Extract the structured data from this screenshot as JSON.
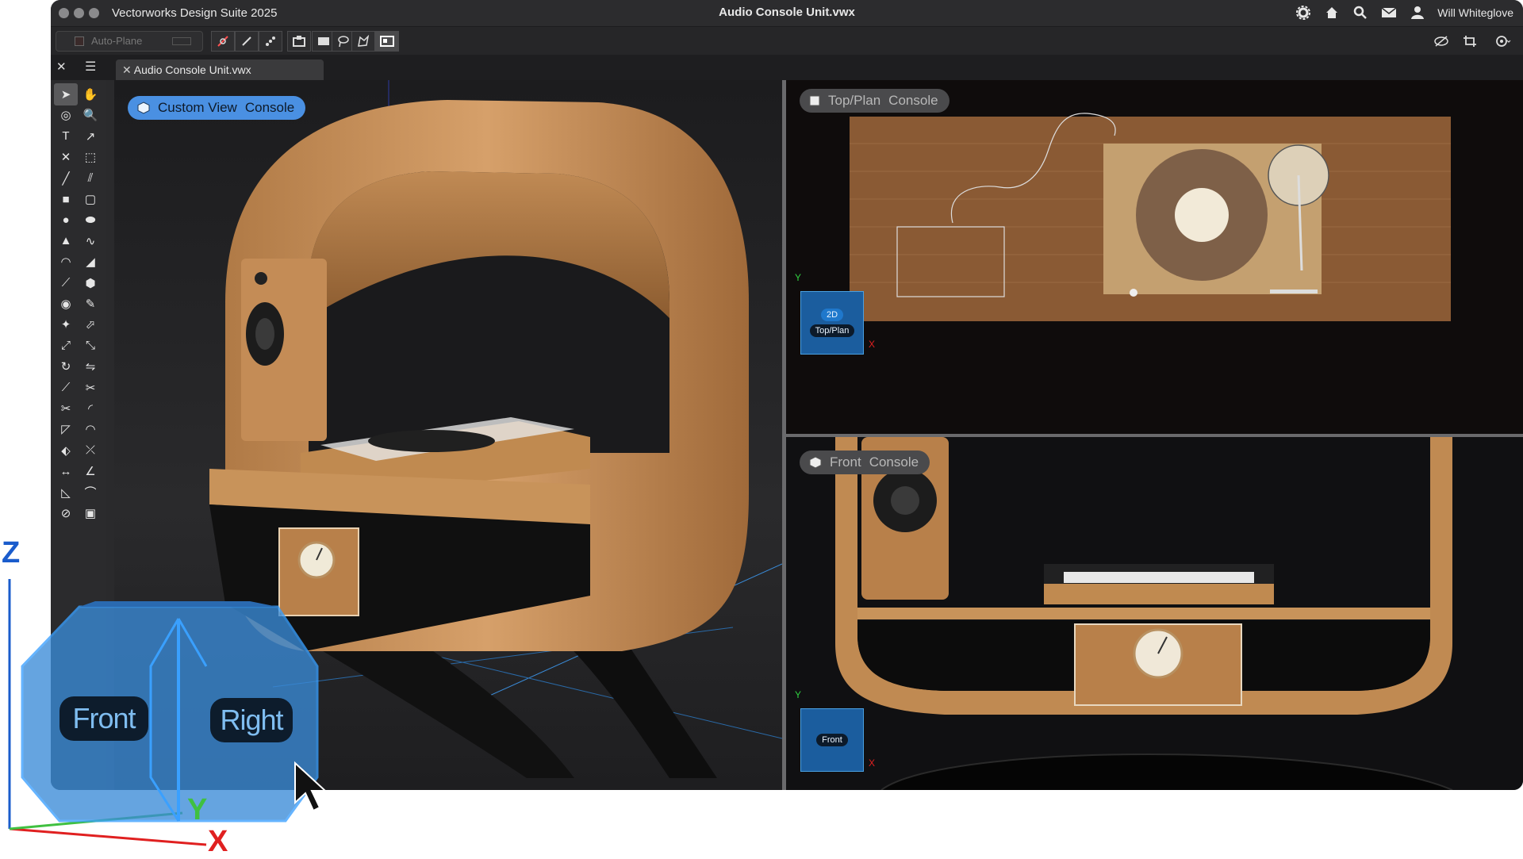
{
  "window": {
    "app_name": "Vectorworks Design Suite 2025",
    "document_title": "Audio Console Unit.vwx",
    "user_name": "Will Whiteglove"
  },
  "toolbar": {
    "autoplane_label": "Auto-Plane"
  },
  "tabs": [
    {
      "label": "Audio Console Unit.vwx"
    }
  ],
  "viewports": {
    "main": {
      "view": "Custom View",
      "layer": "Console"
    },
    "top": {
      "view": "Top/Plan",
      "layer": "Console",
      "badge_mode": "2D",
      "badge_label": "Top/Plan"
    },
    "front": {
      "view": "Front",
      "layer": "Console",
      "badge_label": "Front"
    }
  },
  "view_cube": {
    "faces": [
      "Front",
      "Right"
    ],
    "axes": [
      "Z",
      "Y",
      "X"
    ]
  },
  "mini_axes": {
    "top": [
      "Y",
      "X"
    ],
    "front": [
      "Y",
      "X"
    ]
  },
  "tools": [
    "selection-tool",
    "pan-tool",
    "flyover-tool",
    "zoom-tool",
    "text-tool",
    "callout-tool",
    "locus-tool",
    "push-pull-tool",
    "line-tool",
    "double-line-tool",
    "rectangle-tool",
    "rounded-rectangle-tool",
    "circle-tool",
    "oval-tool",
    "polygon-tool",
    "freehand-tool",
    "arc-tool",
    "shape-tool",
    "polyline-tool",
    "regular-polygon-tool",
    "spiral-tool",
    "eyedropper-tool",
    "magic-wand-tool",
    "reshape-tool",
    "resize-tool",
    "scale-tool",
    "rotate-tool",
    "mirror-tool",
    "knife-tool",
    "trim-tool",
    "split-tool",
    "fillet-tool",
    "chamfer-tool",
    "offset-tool",
    "clip-tool",
    "connect-tool",
    "dimension-tool",
    "angle-dimension-tool",
    "area-tool",
    "surface-tool",
    "protractor-tool",
    "symbol-tool"
  ],
  "colors": {
    "accent": "#4a90e2",
    "cube_blue": "#3a8bd8",
    "axis_x": "#e02020",
    "axis_y": "#40c040",
    "axis_z": "#1a5ccc"
  }
}
